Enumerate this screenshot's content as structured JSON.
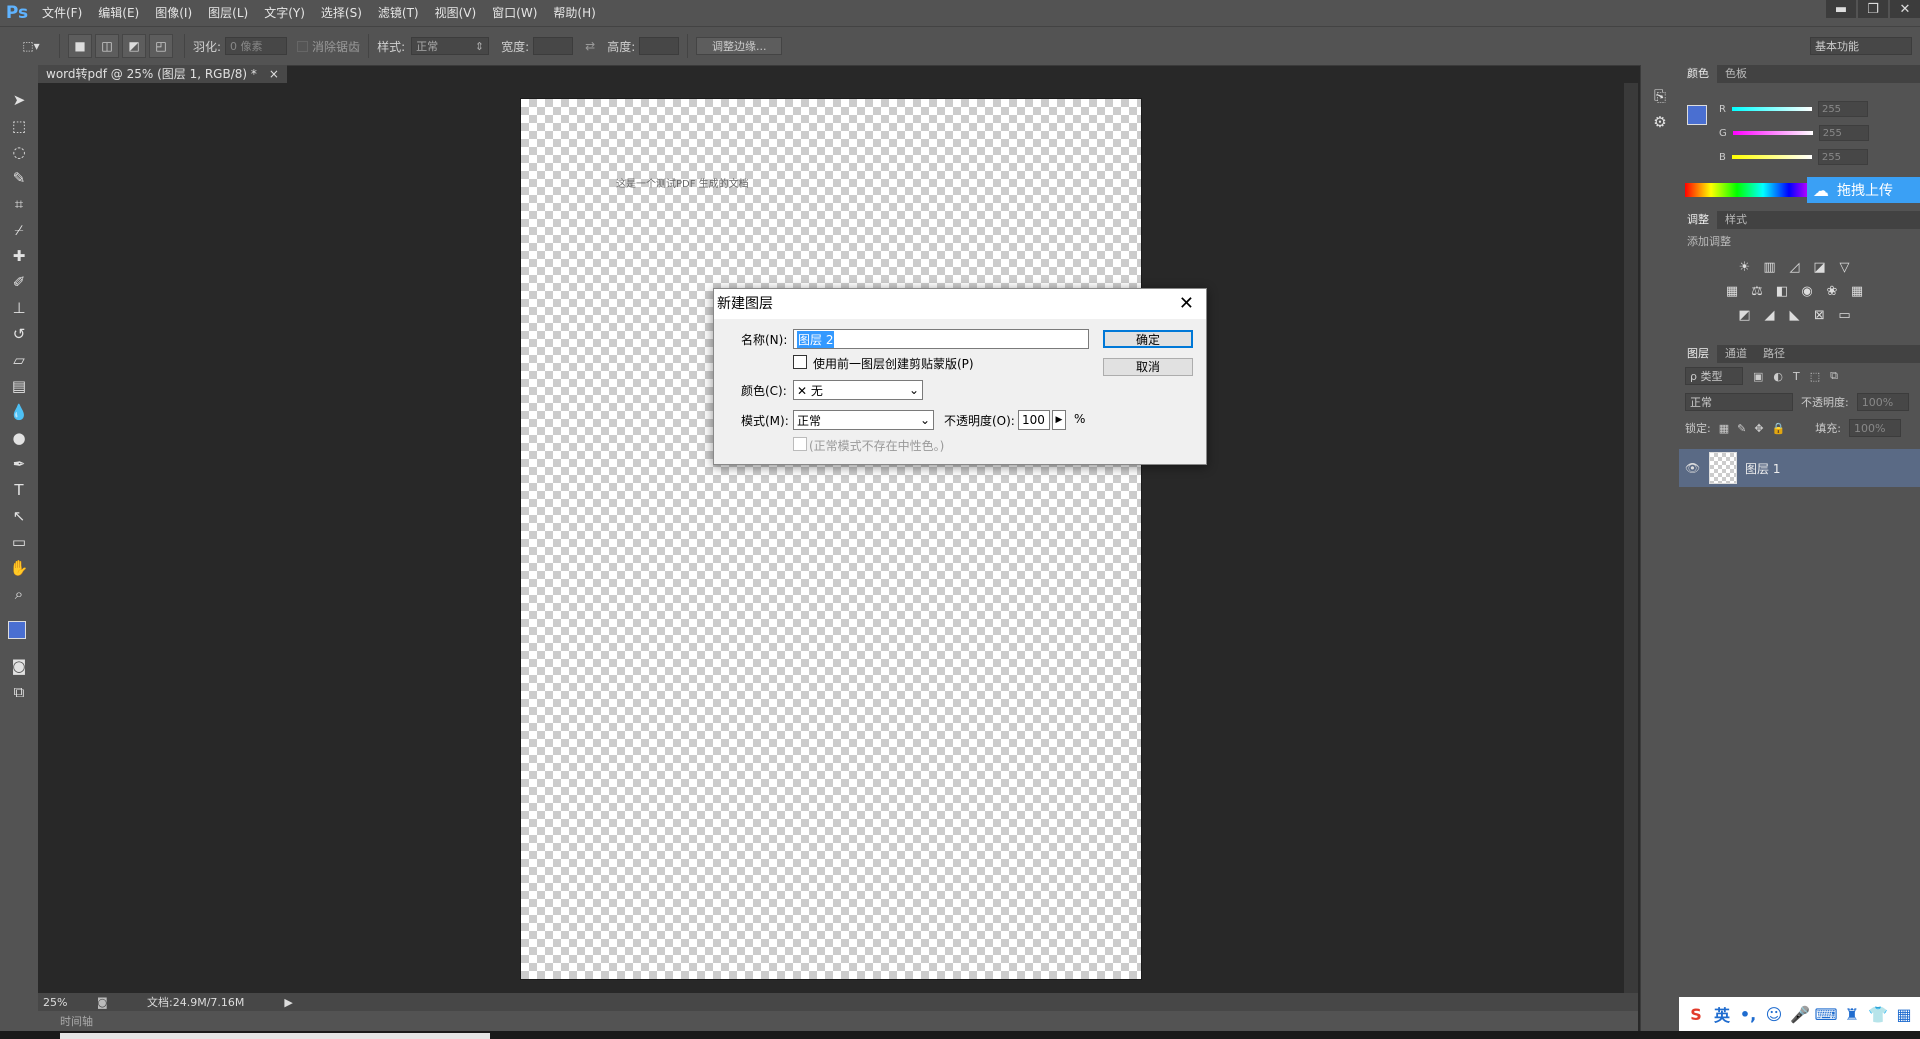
{
  "app": {
    "logo": "Ps"
  },
  "menu": [
    "文件(F)",
    "编辑(E)",
    "图像(I)",
    "图层(L)",
    "文字(Y)",
    "选择(S)",
    "滤镜(T)",
    "视图(V)",
    "窗口(W)",
    "帮助(H)"
  ],
  "window_controls": {
    "minimize": "▬",
    "restore": "❐",
    "close": "✕"
  },
  "options": {
    "feather_label": "羽化:",
    "feather_value": "0 像素",
    "antialias_label": "消除锯齿",
    "style_label": "样式:",
    "style_value": "正常",
    "width_label": "宽度:",
    "height_label": "高度:",
    "refine_button": "调整边缘...",
    "workspace": "基本功能"
  },
  "doc": {
    "tab_title": "word转pdf @ 25% (图层 1, RGB/8) *",
    "close": "×",
    "text": "这是一个测试PDF 生成的文档",
    "zoom": "25%",
    "doc_size": "文档:24.9M/7.16M",
    "timeline": "时间轴"
  },
  "panels": {
    "color_tabs": [
      "颜色",
      "色板"
    ],
    "rgb": [
      {
        "label": "R",
        "value": "255"
      },
      {
        "label": "G",
        "value": "255"
      },
      {
        "label": "B",
        "value": "255"
      }
    ],
    "upload_badge": "拖拽上传",
    "adjust_tabs": [
      "调整",
      "样式"
    ],
    "adjust_title": "添加调整",
    "layers_tabs": [
      "图层",
      "通道",
      "路径"
    ],
    "kind_label": "ρ 类型",
    "blend_mode": "正常",
    "opacity_label": "不透明度:",
    "opacity_value": "100%",
    "lock_label": "锁定:",
    "fill_label": "填充:",
    "fill_value": "100%",
    "layer_name": "图层 1"
  },
  "dialog": {
    "title": "新建图层",
    "name_label": "名称(N):",
    "name_value": "图层 2",
    "ok_button": "确定",
    "cancel_button": "取消",
    "clip_checkbox_label": "使用前一图层创建剪贴蒙版(P)",
    "color_label": "颜色(C):",
    "color_value": "无",
    "mode_label": "模式(M):",
    "mode_value": "正常",
    "opacity_label": "不透明度(O):",
    "opacity_value": "100",
    "opacity_unit": "%",
    "neutral_note": "(正常模式不存在中性色。)"
  },
  "taskbar": {
    "ime": "英"
  },
  "colors": {
    "accent": "#5fb3ff",
    "foreground": "#4a6fd1",
    "layer_selected": "#5a6a85",
    "dialog_bg": "#f0f0f0",
    "upload_badge": "#3aa0f5"
  }
}
